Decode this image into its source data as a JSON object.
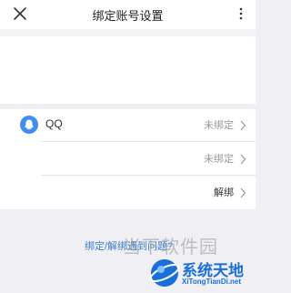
{
  "header": {
    "title": "绑定账号设置",
    "close_icon": "close-icon",
    "more_icon": "more-vertical-icon"
  },
  "accounts": [
    {
      "icon": "qq-icon",
      "label": "QQ",
      "status": "未绑定"
    },
    {
      "icon": "",
      "label": "",
      "status": "未绑定"
    },
    {
      "icon": "",
      "label": "",
      "status": "解绑"
    }
  ],
  "help_link": "绑定/解绑遇到问题?",
  "watermark": {
    "text": "当下软件园",
    "brand": "系统天地",
    "url": "XiTongTianDi.net"
  },
  "colors": {
    "background": "#efeff4",
    "accent": "#3f8ef0",
    "link": "#3a7fd5"
  }
}
